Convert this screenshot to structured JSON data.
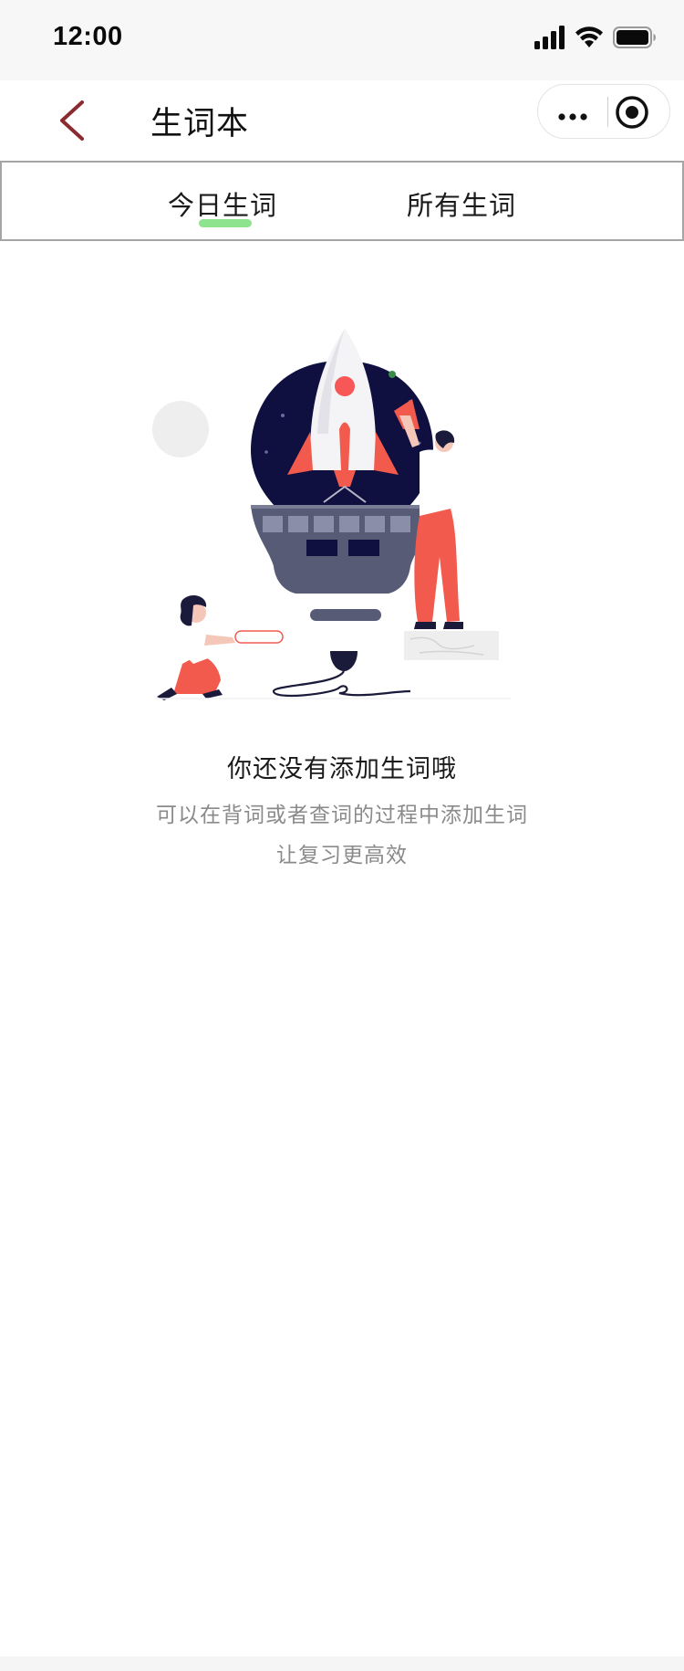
{
  "status_bar": {
    "time": "12:00",
    "icons": [
      "signal-icon",
      "wifi-icon",
      "battery-icon"
    ]
  },
  "nav": {
    "title": "生词本",
    "back_icon": "chevron-left-icon",
    "accent_color": "#8b2b2f"
  },
  "tabs": [
    {
      "label": "今日生词",
      "active": true
    },
    {
      "label": "所有生词",
      "active": false
    }
  ],
  "tab_indicator_color": "#8ee48e",
  "empty_state": {
    "title": "你还没有添加生词哦",
    "description": "可以在背词或者查词的过程中添加生词",
    "description_line2": "让复习更高效"
  }
}
